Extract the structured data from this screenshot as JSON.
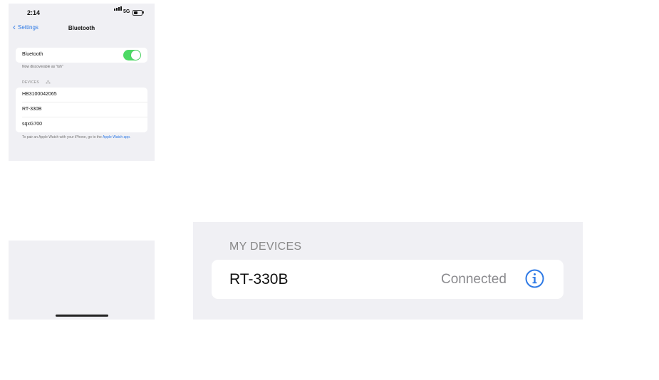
{
  "status_bar": {
    "time": "2:14",
    "network": "5G",
    "battery_level": 0.5
  },
  "nav": {
    "back_label": "Settings",
    "title": "Bluetooth"
  },
  "bluetooth": {
    "label": "Bluetooth",
    "enabled": true,
    "discoverable_text": "Now discoverable as \"tsh\""
  },
  "devices_section": {
    "header": "DEVICES",
    "items": [
      {
        "name": "HB3100042065"
      },
      {
        "name": "RT-330B"
      },
      {
        "name": "sqxG700"
      }
    ]
  },
  "footer": {
    "text": "To pair an Apple Watch with your iPhone, go to the ",
    "link": "Apple Watch app."
  },
  "zoom": {
    "header": "MY DEVICES",
    "device_name": "RT-330B",
    "status": "Connected"
  },
  "colors": {
    "accent": "#2f7ae5",
    "toggle_on": "#4cd964",
    "background": "#f0f0f4"
  }
}
